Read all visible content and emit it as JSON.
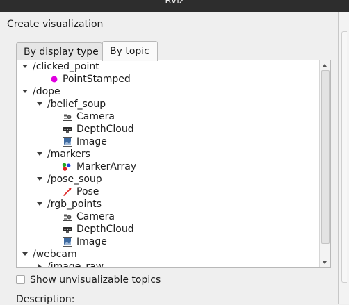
{
  "window": {
    "title": "RViz"
  },
  "dialog": {
    "section_label": "Create visualization",
    "tabs": [
      {
        "label": "By display type",
        "active": false
      },
      {
        "label": "By topic",
        "active": true
      }
    ],
    "tree": [
      {
        "id": "r0",
        "label": "/clicked_point",
        "expanded": true
      },
      {
        "id": "r1",
        "label": "PointStamped",
        "icon": "point-stamped-icon"
      },
      {
        "id": "r2",
        "label": "/dope",
        "expanded": true
      },
      {
        "id": "r3",
        "label": "/belief_soup",
        "expanded": true
      },
      {
        "id": "r4",
        "label": "Camera",
        "icon": "camera-icon"
      },
      {
        "id": "r5",
        "label": "DepthCloud",
        "icon": "depthcloud-icon"
      },
      {
        "id": "r6",
        "label": "Image",
        "icon": "image-icon"
      },
      {
        "id": "r7",
        "label": "/markers",
        "expanded": true
      },
      {
        "id": "r8",
        "label": "MarkerArray",
        "icon": "marker-array-icon"
      },
      {
        "id": "r9",
        "label": "/pose_soup",
        "expanded": true
      },
      {
        "id": "r10",
        "label": "Pose",
        "icon": "pose-icon"
      },
      {
        "id": "r11",
        "label": "/rgb_points",
        "expanded": true
      },
      {
        "id": "r12",
        "label": "Camera",
        "icon": "camera-icon"
      },
      {
        "id": "r13",
        "label": "DepthCloud",
        "icon": "depthcloud-icon"
      },
      {
        "id": "r14",
        "label": "Image",
        "icon": "image-icon"
      },
      {
        "id": "r15",
        "label": "/webcam",
        "expanded": true
      },
      {
        "id": "r16",
        "label": "/image_raw",
        "expanded": false
      }
    ],
    "show_unvisualizable": {
      "label": "Show unvisualizable topics",
      "checked": false
    },
    "description_label": "Description:"
  },
  "colors": {
    "point_stamped": "#e000e0",
    "pose_arrow": "#dd2222",
    "marker_red": "#dd2222",
    "marker_green": "#22aa22",
    "marker_blue": "#2244dd"
  }
}
